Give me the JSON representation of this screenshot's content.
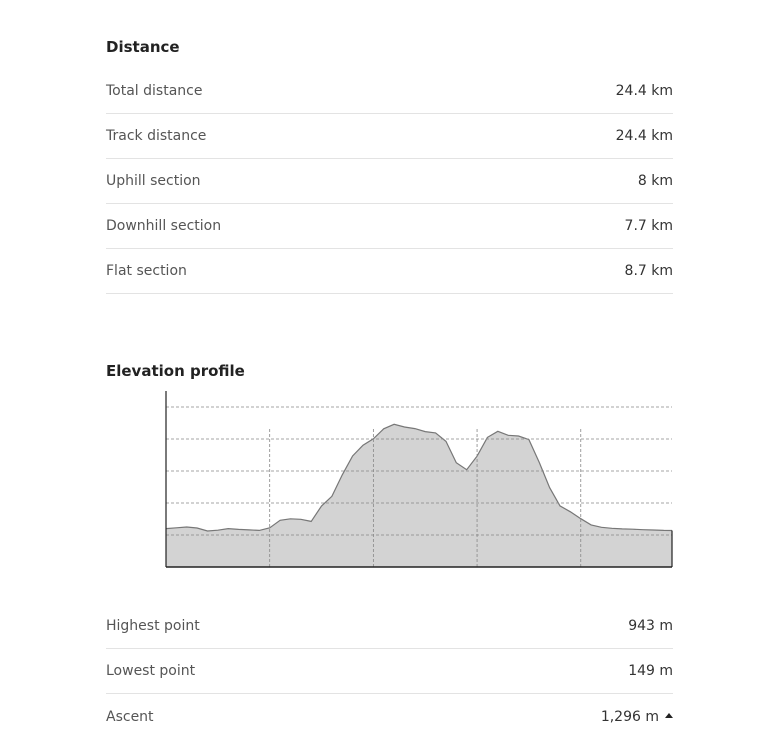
{
  "distance": {
    "title": "Distance",
    "rows": [
      {
        "label": "Total distance",
        "value": "24.4 km"
      },
      {
        "label": "Track distance",
        "value": "24.4 km"
      },
      {
        "label": "Uphill section",
        "value": "8 km"
      },
      {
        "label": "Downhill section",
        "value": "7.7 km"
      },
      {
        "label": "Flat section",
        "value": "8.7 km"
      }
    ]
  },
  "elevation": {
    "title": "Elevation profile",
    "stats": [
      {
        "label": "Highest point",
        "value": "943 m"
      },
      {
        "label": "Lowest point",
        "value": "149 m"
      },
      {
        "label": "Ascent",
        "value": "1,296 m",
        "icon": "caret-up-icon"
      }
    ]
  },
  "chart_data": {
    "type": "area",
    "title": "",
    "xlabel": "",
    "ylabel": "",
    "grid": true,
    "x": [
      0,
      0.5,
      1,
      1.5,
      2,
      2.5,
      3,
      3.5,
      4,
      4.5,
      5,
      5.5,
      6,
      6.5,
      7,
      7.5,
      8,
      8.5,
      9,
      9.5,
      10,
      10.5,
      11,
      11.5,
      12,
      12.5,
      13,
      13.5,
      14,
      14.5,
      15,
      15.5,
      16,
      16.5,
      17,
      17.5,
      18,
      18.5,
      19,
      19.5,
      20,
      20.5,
      21,
      21.5,
      22,
      22.5,
      23,
      23.5,
      24,
      24.4
    ],
    "values": [
      240,
      245,
      250,
      244,
      225,
      230,
      240,
      235,
      232,
      229,
      245,
      292,
      301,
      298,
      285,
      381,
      442,
      576,
      694,
      761,
      801,
      864,
      892,
      875,
      865,
      846,
      838,
      785,
      652,
      608,
      693,
      810,
      848,
      823,
      819,
      796,
      653,
      496,
      382,
      345,
      302,
      263,
      248,
      242,
      238,
      236,
      233,
      231,
      229,
      228
    ],
    "fill_color": "#d3d3d3",
    "line_color": "#777777"
  }
}
